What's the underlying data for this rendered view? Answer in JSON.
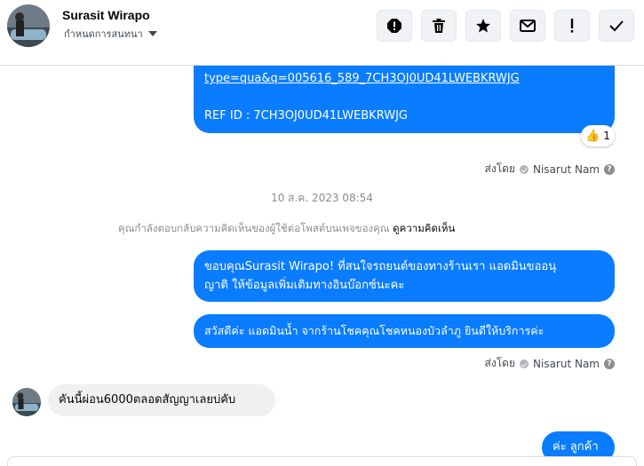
{
  "header": {
    "contact_name": "Surasit Wirapo",
    "assign_label": "กำหนดการสนทนา",
    "actions": [
      {
        "name": "report-icon",
        "label": "!"
      },
      {
        "name": "trash-icon"
      },
      {
        "name": "star-icon"
      },
      {
        "name": "mail-icon"
      },
      {
        "name": "exclamation-icon",
        "label": "!"
      },
      {
        "name": "check-icon"
      }
    ]
  },
  "messages": {
    "m1": {
      "link_text": "type=qua&q=005616_589_7CH3OJ0UD41LWEBKRWJG",
      "ref_text": "REF ID : 7CH3OJ0UD41LWEBKRWJG",
      "reaction_emoji": "👍",
      "reaction_count": "1"
    },
    "sent_by_1": {
      "prefix": "ส่งโดย",
      "name": "Nisarut Nam"
    },
    "timestamp": "10 ส.ค. 2023 08:54",
    "notice": {
      "text": "คุณกำลังตอบกลับความคิดเห็นของผู้ใช้ต่อโพสต์บนเพจของคุณ",
      "link": "ดูความคิดเห็น"
    },
    "m2": {
      "line1": "ขอบคุณSurasit Wirapo! ที่สนใจรถยนต์ของทางร้านเรา แอดมินขออนุ",
      "line2": "ญาติ ให้ข้อมูลเพิ่มเติมทางอินบ๊อกซ์นะคะ"
    },
    "m3": "สวัสดีค่ะ แอดมินน้ำ จากร้านโชคคุณโชคหนองบัวลำภู ยินดีให้บริการค่ะ",
    "sent_by_2": {
      "prefix": "ส่งโดย",
      "name": "Nisarut Nam"
    },
    "m4_incoming": "คันนี้ผ่อน6000ตลอดสัญญาเลยบ่คับ",
    "m5_partial": "ค่ะ ลูกค้า"
  },
  "colors": {
    "outgoing_bubble": "#0a7cff",
    "incoming_bubble": "#f0f0f0",
    "meta_text": "#8a8d91"
  }
}
